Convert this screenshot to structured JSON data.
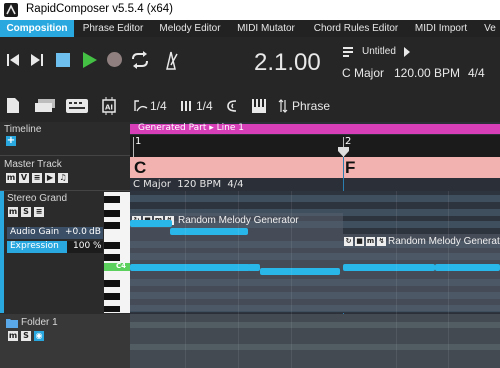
{
  "app": {
    "title": "RapidComposer v5.5.4 (x64)"
  },
  "tabs": [
    {
      "label": "Composition",
      "active": true
    },
    {
      "label": "Phrase Editor"
    },
    {
      "label": "Melody Editor"
    },
    {
      "label": "MIDI Mutator"
    },
    {
      "label": "Chord Rules Editor"
    },
    {
      "label": "MIDI Import"
    },
    {
      "label": "Ve"
    }
  ],
  "transport": {
    "position": "2.1.00",
    "song_name": "Untitled",
    "key": "C Major",
    "tempo": "120.00 BPM",
    "meter": "4/4"
  },
  "toolbar2": {
    "quant1": "1/4",
    "quant2": "1/4",
    "phrase_label": "Phrase"
  },
  "left": {
    "timeline_label": "Timeline",
    "master_track_label": "Master Track",
    "track_name": "Stereo Grand",
    "audio_gain_label": "Audio Gain",
    "audio_gain_value": "+0.0",
    "audio_gain_unit": "dB",
    "expression_label": "Expression",
    "expression_value": "100",
    "expression_unit": "%",
    "expression_level": 1.0,
    "c4_label": "C4",
    "folder_label": "Folder 1"
  },
  "timeline": {
    "generated_part": "Generated Part ▸ Line 1",
    "bar1": "1",
    "bar2": "2",
    "chord1": "C",
    "chord2": "F",
    "info": "C Major  120 BPM  4/4",
    "block1_label": "Random Melody Generator",
    "block2_label": "Random Melody Generator"
  },
  "colors": {
    "accent": "#29a8e0",
    "generated_part": "#d63fb8",
    "chord": "#f2b3b0",
    "note": "#29b6e8",
    "play": "#44c044"
  }
}
